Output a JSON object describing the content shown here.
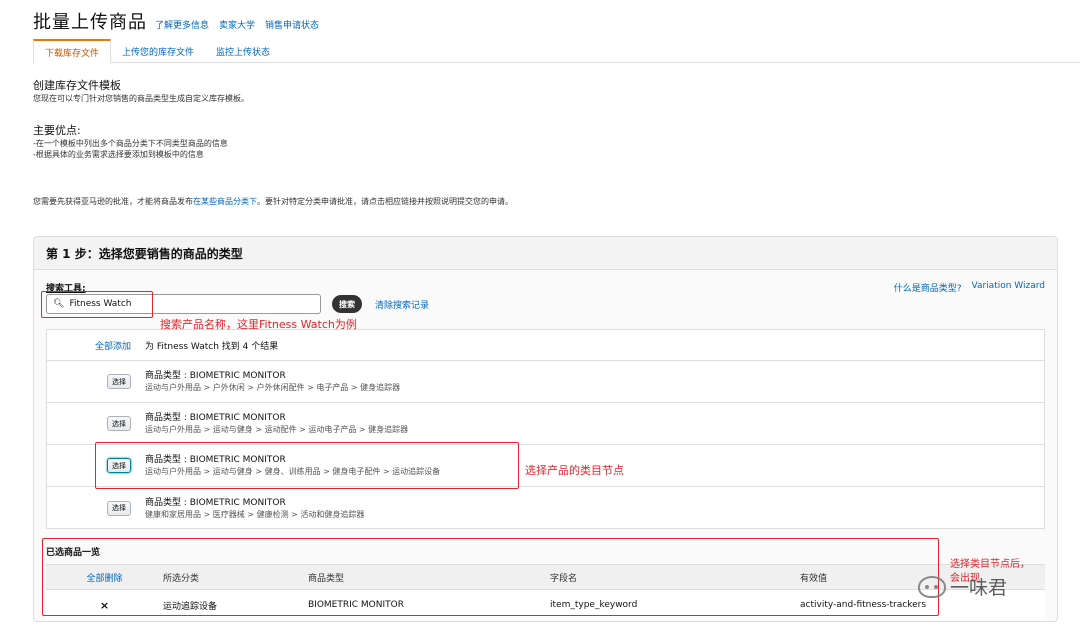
{
  "header": {
    "title": "批量上传商品",
    "links": [
      "了解更多信息",
      "卖家大学",
      "销售申请状态"
    ]
  },
  "tabs": [
    {
      "label": "下载库存文件",
      "active": true
    },
    {
      "label": "上传您的库存文件",
      "active": false
    },
    {
      "label": "监控上传状态",
      "active": false
    }
  ],
  "intro": {
    "title": "创建库存文件模板",
    "text": "您现在可以专门针对您销售的商品类型生成自定义库存模板。"
  },
  "benefits": {
    "title": "主要优点:",
    "items": [
      "-在一个模板中列出多个商品分类下不同类型商品的信息",
      "-根据具体的业务需求选择要添加到模板中的信息"
    ]
  },
  "notice": {
    "before": "您需要先获得亚马逊的批准，才能将商品发布",
    "link": "在某些商品分类下",
    "after": "。要针对特定分类申请批准，请点击相应链接并按照说明提交您的申请。"
  },
  "step": {
    "title": "第 1 步：选择您要销售的商品的类型",
    "search_label": "搜索工具:",
    "help_links": [
      "什么是商品类型?",
      "Variation Wizard"
    ],
    "search_value": "Fitness Watch",
    "search_button": "搜索",
    "clear_link": "清除搜索记录",
    "add_all": "全部添加",
    "results_summary": "为 Fitness Watch 找到 4 个结果",
    "select_label": "选择",
    "results": [
      {
        "type": "商品类型 : BIOMETRIC MONITOR",
        "path": "运动与户外用品 > 户外休闲 > 户外休闲配件 > 电子产品 > 健身追踪器"
      },
      {
        "type": "商品类型 : BIOMETRIC MONITOR",
        "path": "运动与户外用品 > 运动与健身 > 运动配件 > 运动电子产品 > 健身追踪器"
      },
      {
        "type": "商品类型 : BIOMETRIC MONITOR",
        "path": "运动与户外用品 > 运动与健身 > 健身、训练用品 > 健身电子配件 > 运动追踪设备"
      },
      {
        "type": "商品类型 : BIOMETRIC MONITOR",
        "path": "健康和家居用品 > 医疗器械 > 健康检测 > 活动和健身追踪器"
      }
    ],
    "selected_title": "已选商品一览",
    "selected_columns": [
      "全部删除",
      "所选分类",
      "商品类型",
      "字段名",
      "有效值"
    ],
    "selected_rows": [
      {
        "delete": "×",
        "category": "运动追踪设备",
        "product_type": "BIOMETRIC MONITOR",
        "field": "item_type_keyword",
        "value": "activity-and-fitness-trackers"
      }
    ]
  },
  "annotations": {
    "search_note": "搜索产品名称，这里Fitness Watch为例",
    "node_note": "选择产品的类目节点",
    "after_note_line1": "选择类目节点后，",
    "after_note_line2": "会出现"
  },
  "watermark": {
    "text": "一味君",
    "icon": "wechat-icon"
  }
}
